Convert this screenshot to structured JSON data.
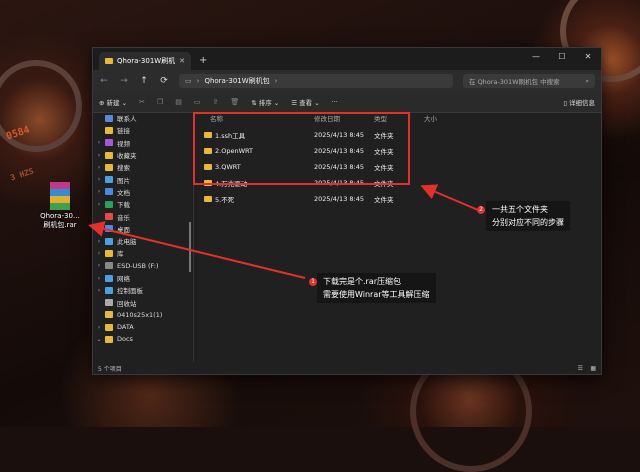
{
  "desktop": {
    "icon_label_line1": "Qhora-30…",
    "icon_label_line2": "刷机包.rar",
    "hud_text_1": "0584",
    "hud_text_2": "3 HZS"
  },
  "window": {
    "tab_title": "Qhora-301W刷机包",
    "new_tab": "+",
    "controls": [
      "—",
      "☐",
      "✕"
    ],
    "address": "Qhora-301W刷机包",
    "search_placeholder": "在 Qhora-301W刷机包 中搜索",
    "toolbar": {
      "new_label": "新建",
      "sort_label": "排序",
      "view_label": "查看",
      "more_label": "···",
      "details_label": "详细信息"
    },
    "sidebar": [
      {
        "label": "联系人",
        "chev": "",
        "color": "#5a8ad6"
      },
      {
        "label": "链接",
        "chev": "",
        "color": "#e7b83b"
      },
      {
        "label": "视频",
        "chev": "›",
        "color": "#a05ad6"
      },
      {
        "label": "收藏夹",
        "chev": "›",
        "color": "#e7b83b"
      },
      {
        "label": "搜索",
        "chev": "›",
        "color": "#e7b83b"
      },
      {
        "label": "图片",
        "chev": "›",
        "color": "#4aa0e0"
      },
      {
        "label": "文档",
        "chev": "›",
        "color": "#4a8ae0"
      },
      {
        "label": "下载",
        "chev": "›",
        "color": "#2aa060"
      },
      {
        "label": "音乐",
        "chev": "",
        "color": "#e04a4a"
      },
      {
        "label": "桌面",
        "chev": "",
        "color": "#4a8ae0"
      },
      {
        "label": "此电脑",
        "chev": "›",
        "color": "#4aa0e0"
      },
      {
        "label": "库",
        "chev": "›",
        "color": "#e7b83b"
      },
      {
        "label": "ESD-USB (F:)",
        "chev": "›",
        "color": "#888"
      },
      {
        "label": "网络",
        "chev": "›",
        "color": "#4aa0e0"
      },
      {
        "label": "控制面板",
        "chev": "›",
        "color": "#4aa0e0"
      },
      {
        "label": "回收站",
        "chev": "",
        "color": "#aaa"
      },
      {
        "label": "0410s25x1(1)",
        "chev": "",
        "color": "#e7b83b"
      },
      {
        "label": "DATA",
        "chev": "›",
        "color": "#e7b83b"
      },
      {
        "label": "Docs",
        "chev": "⌄",
        "color": "#e7b83b"
      }
    ],
    "columns": [
      "名称",
      "修改日期",
      "类型",
      "大小"
    ],
    "files": [
      {
        "name": "1.ssh工具",
        "date": "2025/4/13 8:45",
        "type": "文件夹"
      },
      {
        "name": "2.OpenWRT",
        "date": "2025/4/13 8:45",
        "type": "文件夹"
      },
      {
        "name": "3.QWRT",
        "date": "2025/4/13 8:45",
        "type": "文件夹"
      },
      {
        "name": "4.万兆驱动",
        "date": "2025/4/13 8:45",
        "type": "文件夹"
      },
      {
        "name": "5.不死",
        "date": "2025/4/13 8:45",
        "type": "文件夹"
      }
    ],
    "status": "5 个项目"
  },
  "annotations": {
    "callout1_badge": "1",
    "callout1_line1": "下载完是个.rar压缩包",
    "callout1_line2": "需要使用Winrar等工具解压缩",
    "callout2_badge": "2",
    "callout2_line1": "一共五个文件夹",
    "callout2_line2": "分别对应不同的步骤"
  }
}
